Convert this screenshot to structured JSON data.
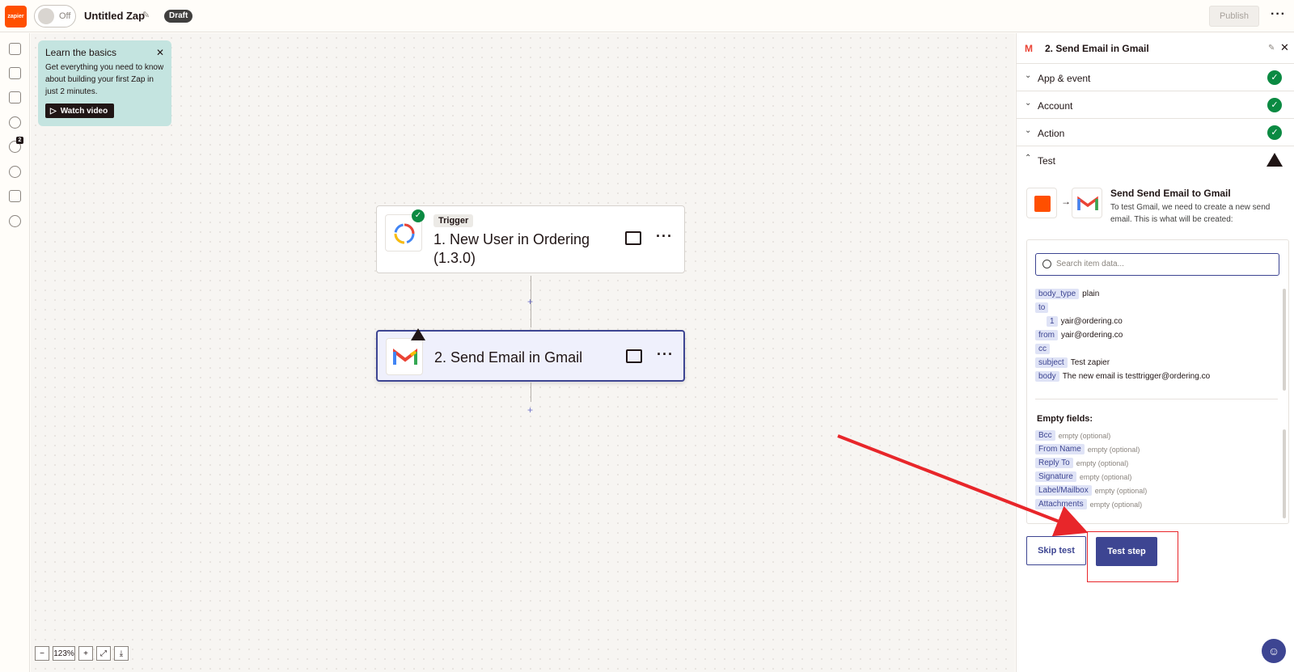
{
  "topbar": {
    "logo_text": "zapier",
    "toggle_label": "Off",
    "zap_title": "Untitled Zap",
    "status_badge": "Draft",
    "publish_label": "Publish",
    "more_icon": "ellipsis-icon"
  },
  "learn": {
    "title": "Learn the basics",
    "body": "Get everything you need to know about building your first Zap in just 2 minutes.",
    "button": "Watch video"
  },
  "steps": [
    {
      "tag": "Trigger",
      "title_line1": "1. New User in Ordering",
      "title_line2": "(1.3.0)",
      "status": "complete"
    },
    {
      "title": "2. Send Email in Gmail",
      "status": "warning"
    }
  ],
  "rail": {
    "notification_count": "2"
  },
  "zoom": {
    "level": "123%"
  },
  "panel": {
    "title": "2. Send Email in Gmail",
    "sections": [
      {
        "label": "App & event",
        "status": "ok"
      },
      {
        "label": "Account",
        "status": "ok"
      },
      {
        "label": "Action",
        "status": "ok"
      },
      {
        "label": "Test",
        "status": "warning"
      }
    ],
    "test": {
      "heading": "Send Send Email to Gmail",
      "description": "To test Gmail, we need to create a new send email. This is what will be created:",
      "search_placeholder": "Search item data...",
      "fields": [
        {
          "key": "body_type",
          "value": "plain"
        },
        {
          "key": "to",
          "value": ""
        },
        {
          "key": "1",
          "value": "yair@ordering.co"
        },
        {
          "key": "from",
          "value": "yair@ordering.co"
        },
        {
          "key": "cc",
          "value": ""
        },
        {
          "key": "subject",
          "value": "Test zapier"
        },
        {
          "key": "body",
          "value": "The new email is testtrigger@ordering.co"
        }
      ],
      "empty_title": "Empty fields:",
      "empty_fields": [
        {
          "key": "Bcc",
          "value": "empty (optional)"
        },
        {
          "key": "From Name",
          "value": "empty (optional)"
        },
        {
          "key": "Reply To",
          "value": "empty (optional)"
        },
        {
          "key": "Signature",
          "value": "empty (optional)"
        },
        {
          "key": "Label/Mailbox",
          "value": "empty (optional)"
        },
        {
          "key": "Attachments",
          "value": "empty (optional)"
        }
      ],
      "skip_label": "Skip test",
      "test_label": "Test step"
    }
  },
  "colors": {
    "brand": "#ff4f00",
    "accent": "#3d4592",
    "success": "#0b8a42",
    "annotation": "#e8262a"
  }
}
